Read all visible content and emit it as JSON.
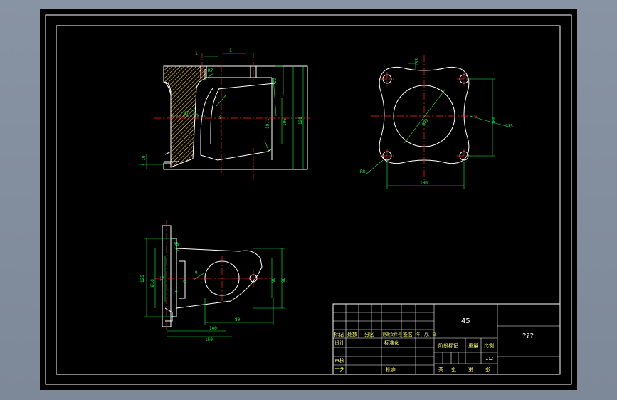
{
  "colors": {
    "background": "#000000",
    "frame": "#ffffff",
    "outline": "#ffffff",
    "centerline": "#ff2020",
    "dimension": "#00ff40",
    "hatch": "#ffd700",
    "titleblock_text": "#ffff66"
  },
  "title_block": {
    "material": "45",
    "drawing_name": "???",
    "scale": "1:2",
    "header_row": [
      "标记",
      "处数",
      "分区",
      "更改文件号",
      "签名",
      "年、月、日"
    ],
    "row_design": "设计",
    "row_standardize": "标准化",
    "row_review": "审核",
    "row_process": "工艺",
    "row_approve": "批准",
    "stage_mark": "阶段标记",
    "weight": "重量",
    "ratio_label": "比例",
    "sheet_total": "共",
    "sheet_unit1": "张",
    "sheet_current": "第",
    "sheet_unit2": "张"
  },
  "dimensions": {
    "front_view": [
      "1",
      "1",
      "R7",
      "9",
      "10.1",
      "120",
      "106",
      "47",
      "4-10",
      "12"
    ],
    "top_view": [
      "135",
      "Ø82",
      "100",
      "100",
      "115",
      "R8"
    ],
    "side_view": [
      "125",
      "Ø10",
      "75",
      "8",
      "R8",
      "4",
      "9",
      "90",
      "98",
      "80",
      "140",
      "150"
    ]
  }
}
